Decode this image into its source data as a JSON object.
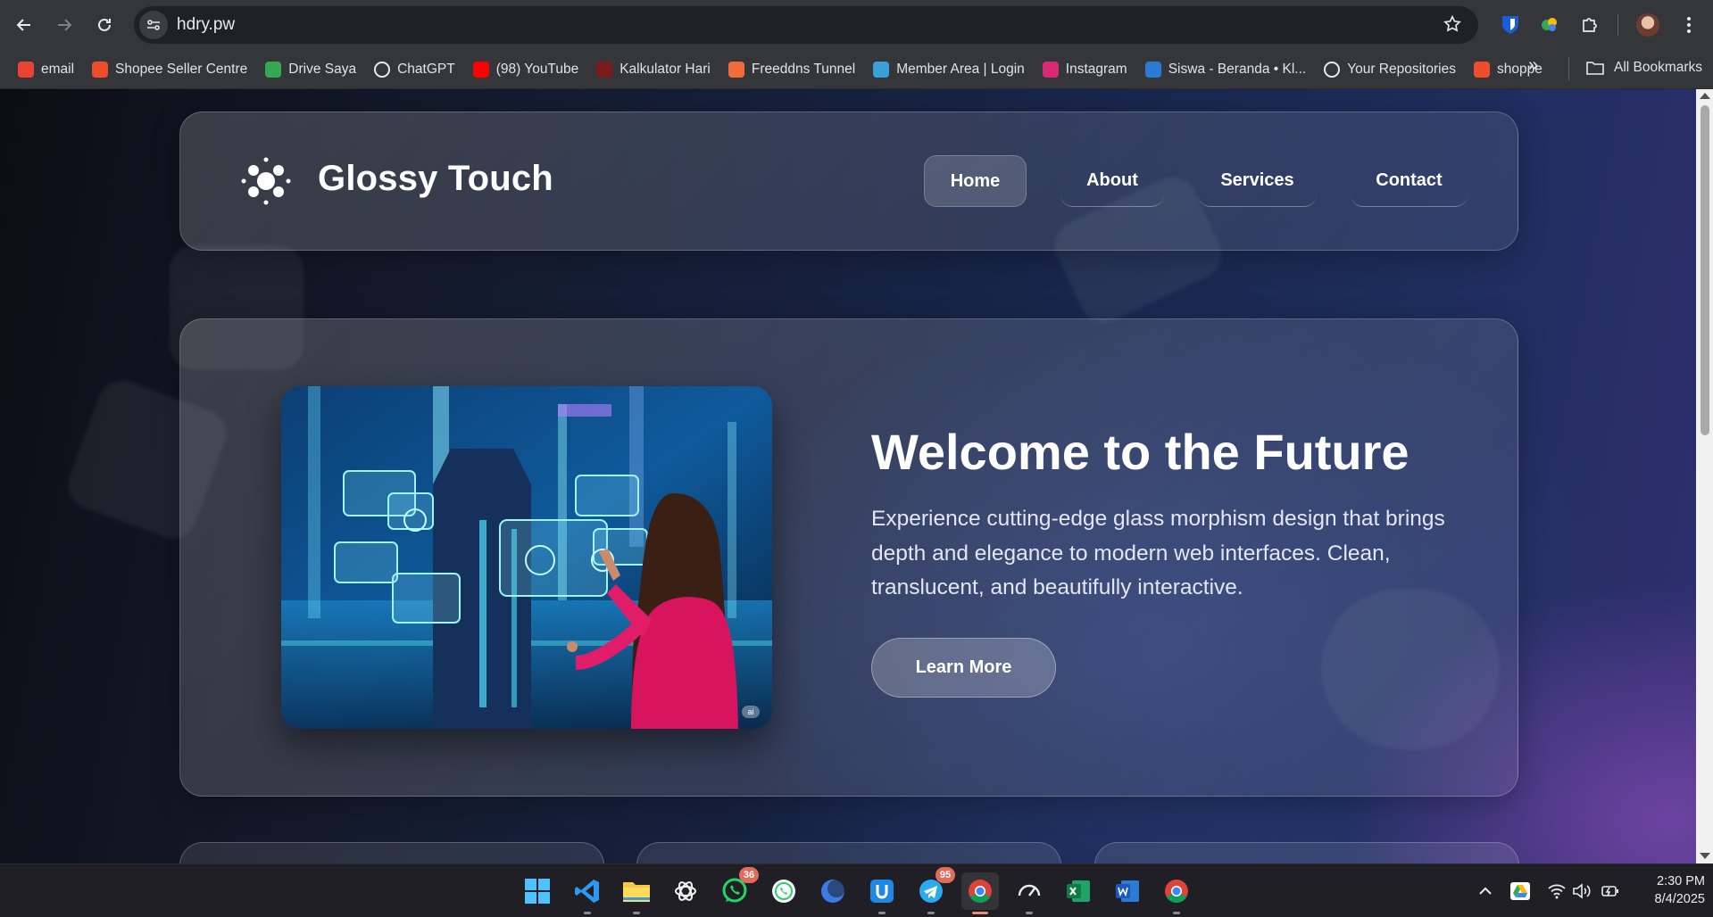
{
  "browser": {
    "url": "hdry.pw",
    "bookmarks": [
      {
        "label": "email",
        "icon": "gmail-icon",
        "color": "#ea4335"
      },
      {
        "label": "Shopee Seller Centre",
        "icon": "shopee-icon",
        "color": "#ee4d2d"
      },
      {
        "label": "Drive Saya",
        "icon": "google-drive-icon",
        "color": "#34a853"
      },
      {
        "label": "ChatGPT",
        "icon": "chatgpt-icon",
        "color": "#e8eaed"
      },
      {
        "label": "(98) YouTube",
        "icon": "youtube-icon",
        "color": "#ff0000"
      },
      {
        "label": "Kalkulator Hari",
        "icon": "calculator-icon",
        "color": "#7a1c1c"
      },
      {
        "label": "Freeddns Tunnel",
        "icon": "tunnel-icon",
        "color": "#f26b3a"
      },
      {
        "label": "Member Area | Login",
        "icon": "member-area-icon",
        "color": "#3aa0d8"
      },
      {
        "label": "Instagram",
        "icon": "instagram-icon",
        "color": "#d62976"
      },
      {
        "label": "Siswa - Beranda • Kl...",
        "icon": "siswa-icon",
        "color": "#2b7bd6"
      },
      {
        "label": "Your Repositories",
        "icon": "github-icon",
        "color": "#e8eaed"
      },
      {
        "label": "shoppe",
        "icon": "shopee-icon",
        "color": "#ee4d2d"
      }
    ],
    "more_label": "»",
    "all_bookmarks": "All Bookmarks"
  },
  "site": {
    "brand": "Glossy Touch",
    "nav": [
      "Home",
      "About",
      "Services",
      "Contact"
    ],
    "active_nav": "Home",
    "hero": {
      "title": "Welcome to the Future",
      "text": "Experience cutting-edge glass morphism design that brings depth and elegance to modern web interfaces. Clean, translucent, and beautifully interactive.",
      "button": "Learn More",
      "image_badge": "ai"
    }
  },
  "taskbar": {
    "whatsapp_badge": "36",
    "telegram_badge": "95",
    "time": "2:30 PM",
    "date": "8/4/2025"
  },
  "colors": {
    "accent": "#f08a6c",
    "badge": "#e06c5c"
  }
}
